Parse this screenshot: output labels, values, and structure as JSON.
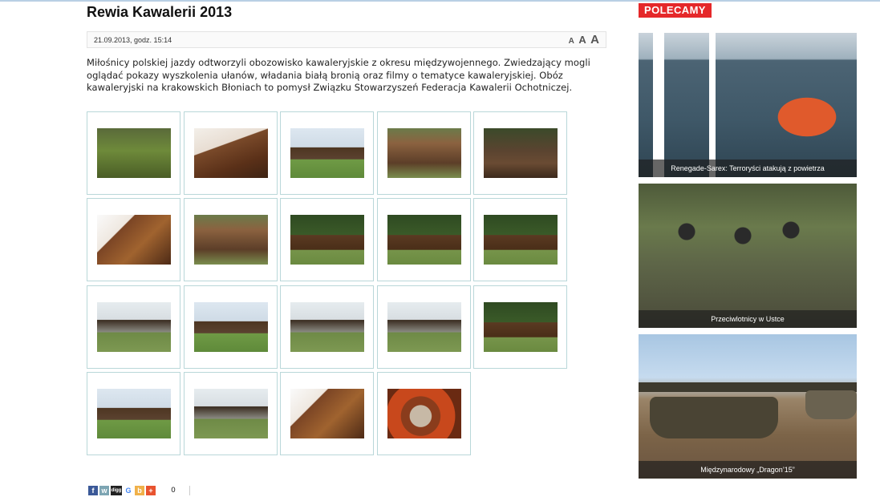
{
  "article": {
    "title": "Rewia Kawalerii 2013",
    "date": "21.09.2013, godz. 15:14",
    "font_sizes": [
      "A",
      "A",
      "A"
    ],
    "lead": "Miłośnicy polskiej jazdy odtworzyli obozowisko kawaleryjskie z okresu międzywojennego. Zwiedzający mogli oglądać pokazy wyszkolenia ułanów, władania białą bronią oraz filmy o tematyce kawaleryjskiej. Obóz kawaleryjski na krakowskich Błoniach to pomysł Związku Stowarzyszeń Federacja Kawalerii Ochotniczej."
  },
  "gallery": {
    "count": 19
  },
  "share": {
    "icons": [
      "facebook-icon",
      "wykop-icon",
      "digg-icon",
      "google-icon",
      "blip-icon",
      "google-plus-icon"
    ],
    "labels": [
      "f",
      "w",
      "digg",
      "G",
      "b",
      "+"
    ],
    "count": "0"
  },
  "sidebar": {
    "label": "POLECAMY",
    "items": [
      {
        "caption": "Renegade-Sarex: Terroryści atakują z powietrza"
      },
      {
        "caption": "Przeciwlotnicy w Ustce"
      },
      {
        "caption": "Międzynarodowy „Dragon’15”"
      }
    ]
  },
  "colors": {
    "accent_red": "#e5282a",
    "thumb_border": "#b9d7d9",
    "caption_overlay": "#1e1e1e"
  }
}
